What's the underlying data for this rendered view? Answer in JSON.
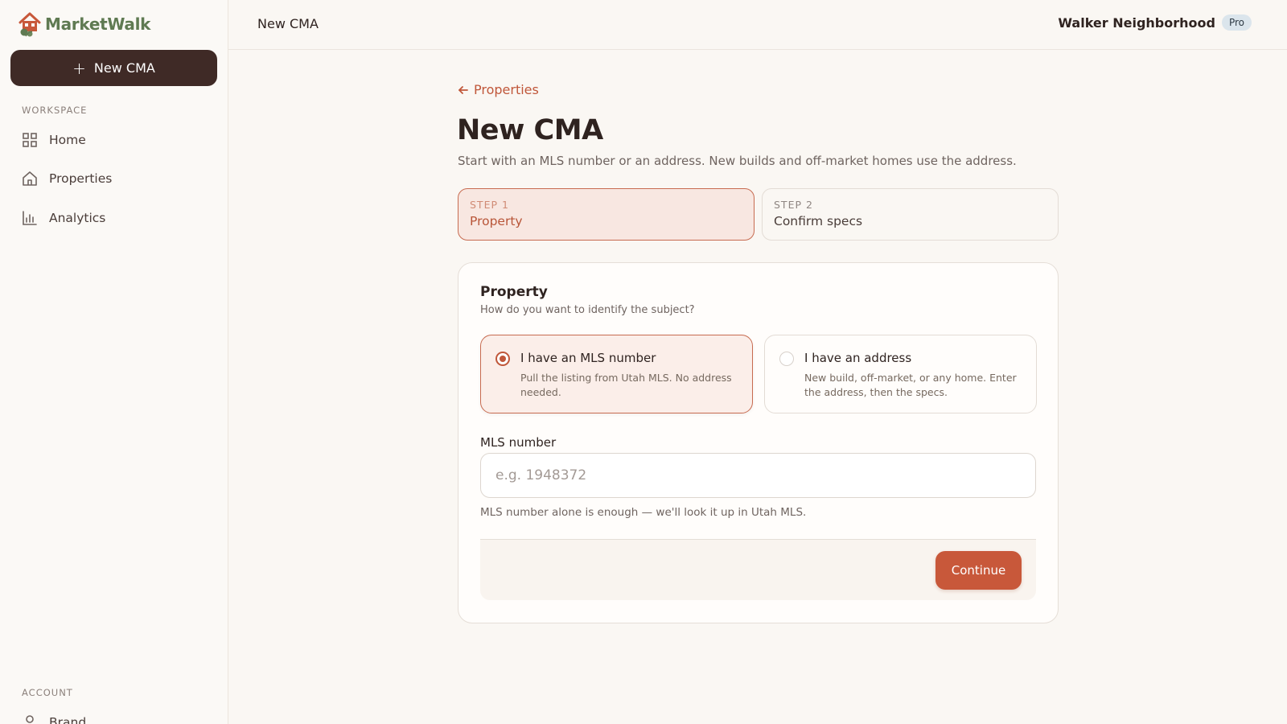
{
  "app": {
    "name": "MarketWalk"
  },
  "sidebar": {
    "new_button_label": "New CMA",
    "workspace_label": "WORKSPACE",
    "items": [
      {
        "label": "Home",
        "icon": "grid-icon"
      },
      {
        "label": "Properties",
        "icon": "house-icon"
      },
      {
        "label": "Analytics",
        "icon": "bar-chart-icon"
      }
    ],
    "account_label": "ACCOUNT",
    "account_items": [
      {
        "label": "Brand",
        "icon": "user-icon"
      }
    ]
  },
  "header": {
    "title": "New CMA",
    "workspace_name": "Walker Neighborhood",
    "plan_badge": "Pro"
  },
  "main": {
    "back_link": "Properties",
    "title": "New CMA",
    "subtitle": "Start with an MLS number or an address. New builds and off-market homes use the address.",
    "steps": [
      {
        "num": "STEP 1",
        "label": "Property",
        "active": true
      },
      {
        "num": "STEP 2",
        "label": "Confirm specs",
        "active": false
      }
    ],
    "card": {
      "title": "Property",
      "subtitle": "How do you want to identify the subject?",
      "options": [
        {
          "title": "I have an MLS number",
          "desc": "Pull the listing from Utah MLS. No address needed.",
          "selected": true
        },
        {
          "title": "I have an address",
          "desc": "New build, off-market, or any home. Enter the address, then the specs.",
          "selected": false
        }
      ],
      "field_label": "MLS number",
      "field_value": "",
      "field_placeholder": "e.g. 1948372",
      "field_help": "MLS number alone is enough — we'll look it up in Utah MLS.",
      "continue_label": "Continue"
    }
  },
  "colors": {
    "accent": "#c8583a",
    "dark_button": "#3f2a26",
    "brand_green": "#5f7a52",
    "background": "#faf7f3"
  }
}
